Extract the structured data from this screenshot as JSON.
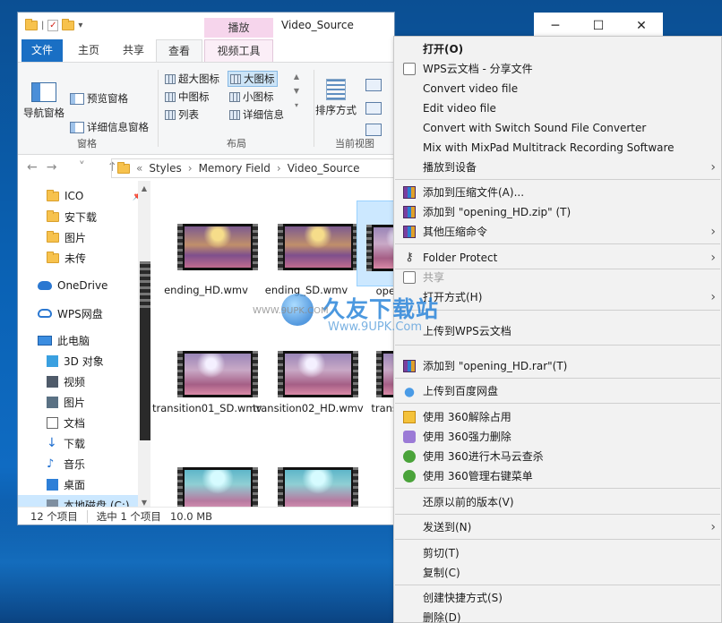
{
  "colors": {
    "accent": "#1a6fc4",
    "selection": "#cce8ff",
    "video_tools_tab": "#f6d5ec",
    "menu_bg": "#f2f2f2"
  },
  "explorer": {
    "window_title": "Video_Source",
    "tool_group": "播放",
    "tabs": {
      "file": "文件",
      "home": "主页",
      "share": "共享",
      "view": "查看",
      "video_tools": "视频工具"
    },
    "ribbon": {
      "nav_pane": "导航窗格",
      "preview_pane": "预览窗格",
      "details_pane": "详细信息窗格",
      "pane_group": "窗格",
      "extra_large": "超大图标",
      "large": "大图标",
      "medium": "中图标",
      "small": "小图标",
      "list": "列表",
      "details": "详细信息",
      "layout_group": "布局",
      "sort_by": "排序方式",
      "current_view_group": "当前视图"
    },
    "address": {
      "prefix": "«",
      "parts": [
        "Styles",
        "Memory Field",
        "Video_Source"
      ]
    },
    "nav_items": {
      "ico": "ICO",
      "downloads_cn": "安下载",
      "pictures_folder": "图片",
      "unsent": "未传",
      "onedrive": "OneDrive",
      "wps": "WPS网盘",
      "this_pc": "此电脑",
      "objects3d": "3D 对象",
      "videos": "视频",
      "pictures": "图片",
      "documents": "文档",
      "downloads": "下载",
      "music": "音乐",
      "desktop": "桌面",
      "local_disk": "本地磁盘 (C:)"
    },
    "files": [
      {
        "name": "ending_HD.wmv"
      },
      {
        "name": "ending_SD.wmv"
      },
      {
        "name": "open"
      },
      {
        "name": "transition01_SD.wmv"
      },
      {
        "name": "transition02_HD.wmv"
      },
      {
        "name": "transit"
      },
      {
        "name": ""
      },
      {
        "name": ""
      }
    ],
    "status": {
      "count": "12 个项目",
      "selected": "选中 1 个项目",
      "size": "10.0 MB"
    }
  },
  "window_controls": {
    "minimize": "─",
    "maximize": "☐",
    "close": "✕"
  },
  "watermark": {
    "main": "久友下载站",
    "url": "WWW.9UPK.COM",
    "sub": "Www.9UPK.Com"
  },
  "context_menu": {
    "open": "打开(O)",
    "wps_share": "WPS云文档 - 分享文件",
    "convert_video": "Convert video file",
    "edit_video": "Edit video file",
    "convert_switch": "Convert with Switch Sound File Converter",
    "mix_mixpad": "Mix with MixPad Multitrack Recording Software",
    "cast": "播放到设备",
    "add_archive": "添加到压缩文件(A)...",
    "add_zip": "添加到 \"opening_HD.zip\" (T)",
    "other_compress": "其他压缩命令",
    "folder_protect": "Folder Protect",
    "share": "共享",
    "open_with": "打开方式(H)",
    "upload_wps": "上传到WPS云文档",
    "add_rar": "添加到 \"opening_HD.rar\"(T)",
    "upload_baidu": "上传到百度网盘",
    "unlock_360": "使用 360解除占用",
    "force_delete_360": "使用 360强力删除",
    "scan_360": "使用 360进行木马云查杀",
    "manage_360": "使用 360管理右键菜单",
    "restore": "还原以前的版本(V)",
    "send_to": "发送到(N)",
    "cut": "剪切(T)",
    "copy": "复制(C)",
    "shortcut": "创建快捷方式(S)",
    "delete": "删除(D)"
  }
}
